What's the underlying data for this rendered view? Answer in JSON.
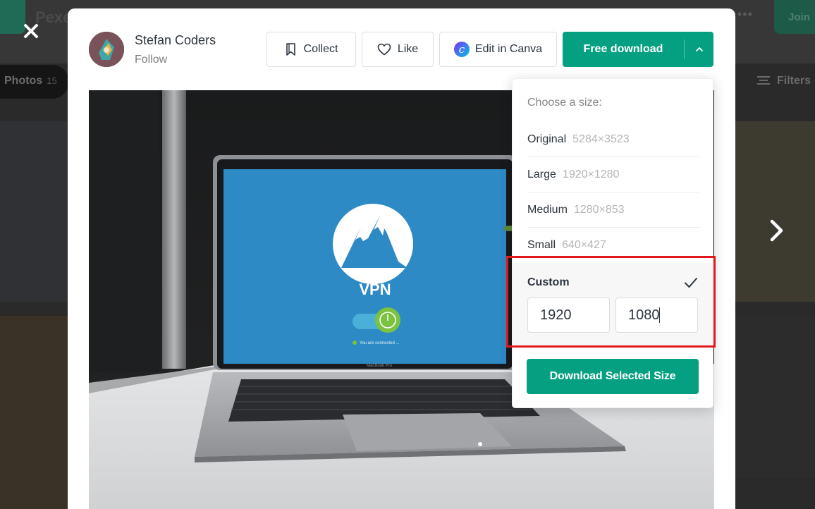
{
  "background": {
    "site_name": "Pexe",
    "join_label": "Join",
    "photos_tab_label": "Photos",
    "photos_tab_count": "15",
    "filters_label": "Filters"
  },
  "author": {
    "name": "Stefan Coders",
    "follow_label": "Follow"
  },
  "actions": {
    "collect_label": "Collect",
    "like_label": "Like",
    "canva_label": "Edit in Canva",
    "free_download_label": "Free download"
  },
  "photo": {
    "screen_text": "VPN",
    "status_text": "You are connected ...",
    "brand_text": "MacBook Pro"
  },
  "size_menu": {
    "title": "Choose a size:",
    "options": [
      {
        "name": "Original",
        "dimensions": "5284×3523"
      },
      {
        "name": "Large",
        "dimensions": "1920×1280"
      },
      {
        "name": "Medium",
        "dimensions": "1280×853"
      },
      {
        "name": "Small",
        "dimensions": "640×427"
      }
    ],
    "custom": {
      "label": "Custom",
      "selected": true,
      "width_value": "1920",
      "height_value": "1080"
    },
    "download_selected_label": "Download Selected Size"
  },
  "colors": {
    "accent": "#05a081",
    "highlight": "#e1181b",
    "screen_blue": "#2d8ac4"
  },
  "icons": [
    "close-icon",
    "next-arrow-icon",
    "bookmark-icon",
    "heart-icon",
    "canva-logo-icon",
    "chevron-up-icon",
    "checkmark-icon",
    "filters-icon"
  ]
}
